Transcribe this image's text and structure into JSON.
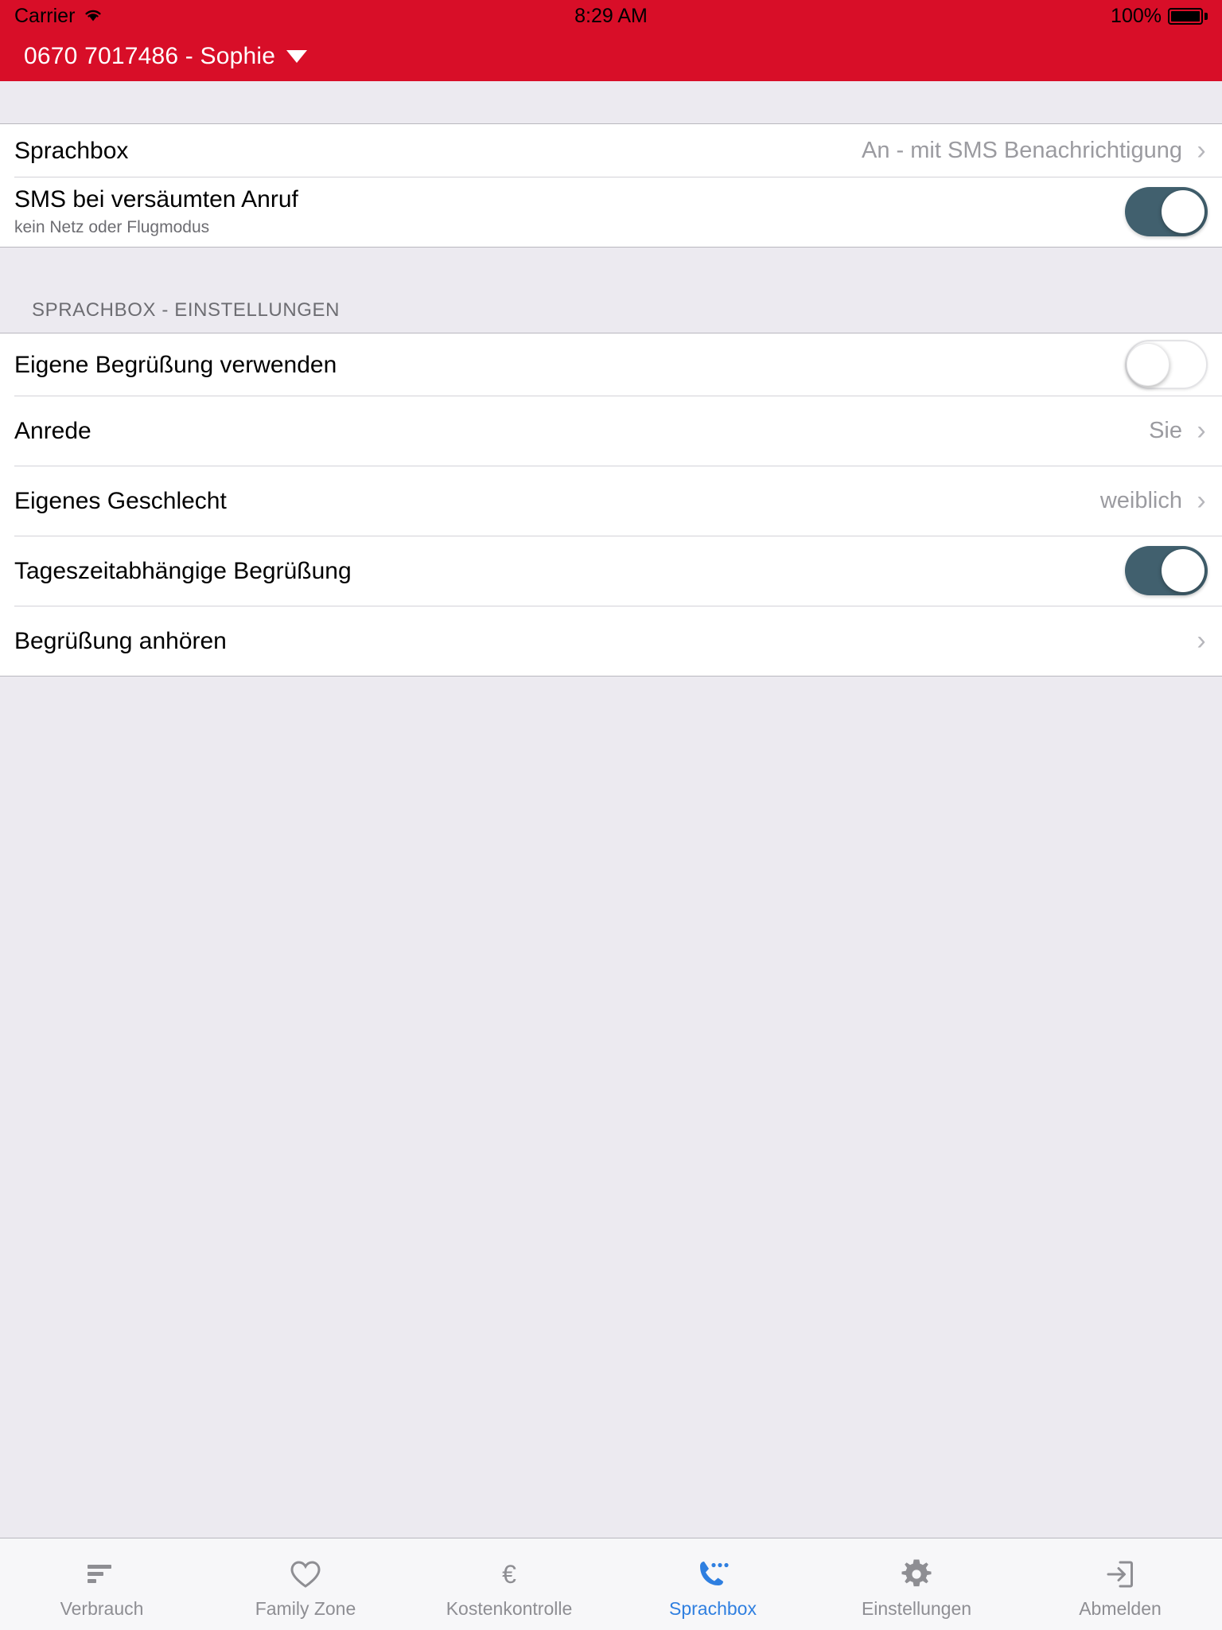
{
  "statusbar": {
    "carrier": "Carrier",
    "wifi_icon": "wifi-icon",
    "time": "8:29 AM",
    "battery_percent": "100%",
    "battery_icon": "battery-full-icon"
  },
  "header": {
    "title": "0670 7017486 - Sophie",
    "caret_icon": "chevron-down-icon",
    "background_color": "#d80e28"
  },
  "sections": [
    {
      "header": "",
      "rows": [
        {
          "name": "sprachbox",
          "title": "Sprachbox",
          "subtitle": "",
          "value": "An - mit SMS Benachrichtigung",
          "control": "chevron",
          "chevron": "›"
        },
        {
          "name": "sms-bei-versaeumten-anruf",
          "title": "SMS bei versäumten Anruf",
          "subtitle": "kein Netz oder Flugmodus",
          "value": "",
          "control": "switch",
          "switch_state": "on"
        }
      ]
    },
    {
      "header": "SPRACHBOX - EINSTELLUNGEN",
      "rows": [
        {
          "name": "eigene-begruessung-verwenden",
          "title": "Eigene Begrüßung verwenden",
          "subtitle": "",
          "value": "",
          "control": "switch",
          "switch_state": "off"
        },
        {
          "name": "anrede",
          "title": "Anrede",
          "subtitle": "",
          "value": "Sie",
          "control": "chevron",
          "chevron": "›"
        },
        {
          "name": "eigenes-geschlecht",
          "title": "Eigenes Geschlecht",
          "subtitle": "",
          "value": "weiblich",
          "control": "chevron",
          "chevron": "›"
        },
        {
          "name": "tageszeitabhaengige-begruessung",
          "title": "Tageszeitabhängige Begrüßung",
          "subtitle": "",
          "value": "",
          "control": "switch",
          "switch_state": "on"
        },
        {
          "name": "begruessung-anhoeren",
          "title": "Begrüßung anhören",
          "subtitle": "",
          "value": "",
          "control": "chevron",
          "chevron": "›"
        }
      ]
    }
  ],
  "tabbar": {
    "active_color": "#2f7fe0",
    "inactive_color": "#8e8e93",
    "tabs": [
      {
        "label": "Verbrauch",
        "icon": "bars-icon",
        "active": false
      },
      {
        "label": "Family Zone",
        "icon": "heart-icon",
        "active": false
      },
      {
        "label": "Kostenkontrolle",
        "icon": "euro-icon",
        "active": false
      },
      {
        "label": "Sprachbox",
        "icon": "phone-dots-icon",
        "active": true
      },
      {
        "label": "Einstellungen",
        "icon": "gear-icon",
        "active": false
      },
      {
        "label": "Abmelden",
        "icon": "logout-icon",
        "active": false
      }
    ]
  },
  "colors": {
    "brand_red": "#d80e28",
    "switch_on": "#41606e",
    "page_background": "#eceaf0"
  }
}
